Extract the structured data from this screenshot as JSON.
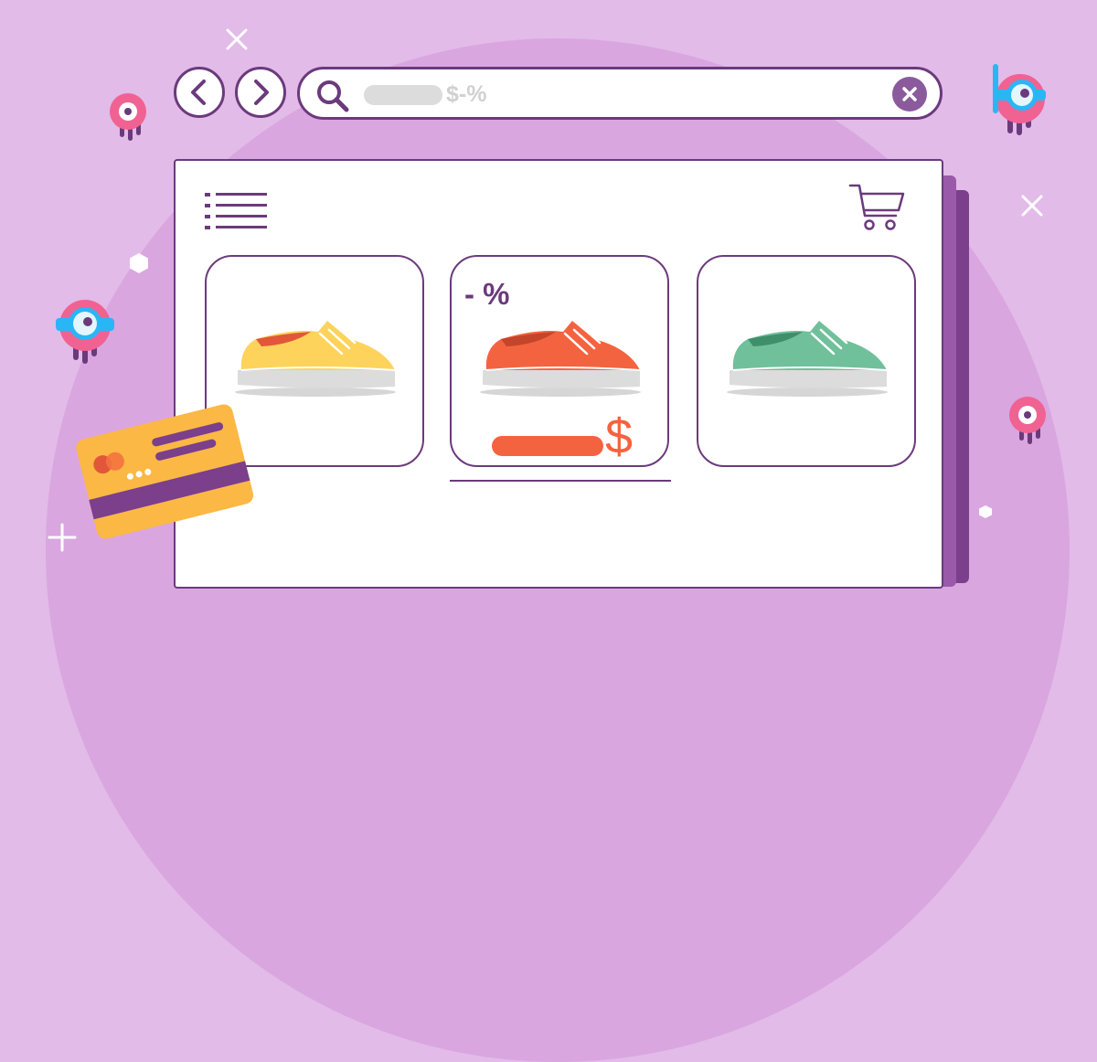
{
  "search": {
    "query": "$-%"
  },
  "products": [
    {
      "shoe_color": "#fdd35b",
      "discount_label": "",
      "has_price": false
    },
    {
      "shoe_color": "#f4633f",
      "discount_label": "- %",
      "has_price": true,
      "price_symbol": "$"
    },
    {
      "shoe_color": "#6fc09b",
      "discount_label": "",
      "has_price": false
    }
  ],
  "icons": {
    "back": "chevron-left-icon",
    "forward": "chevron-right-icon",
    "search": "search-icon",
    "clear": "close-icon",
    "menu": "list-menu-icon",
    "cart": "shopping-cart-icon",
    "card": "credit-card-icon"
  },
  "colors": {
    "background": "#e2bbe8",
    "accent": "#6b3a7c",
    "sale": "#f4633f"
  }
}
